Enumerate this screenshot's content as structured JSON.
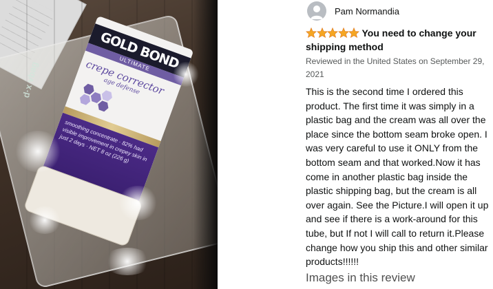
{
  "photo": {
    "alt": "Customer photo of Gold Bond crepe corrector tube in a plastic bag",
    "brand_text": "GOLD BOND",
    "sub_text": "ULTIMATE",
    "product_line1": "crepe corrector",
    "product_line2": "age defense",
    "purple_text": "smoothing concentrate · 82% had visible improvement in crepey skin in just 2 days · NET 8 oz (226 g)",
    "side_text": "d·x vbag"
  },
  "review": {
    "reviewer_name": "Pam Normandia",
    "rating": 5,
    "title": "You need to change your shipping method",
    "meta": "Reviewed in the United States on September 29, 2021",
    "body": "This is the second time I ordered this product. The first time it was simply in a plastic bag and the cream was all over the place since the bottom seam broke open. I was very careful to use it ONLY from the bottom seam and that worked.Now it has come in another plastic bag inside the plastic shipping bag, but the cream is all over again. See the Picture.I will open it up and see if there is a work-around for this tube, but If not I will call to return it.Please change how you ship this and other similar products!!!!!!",
    "images_heading": "Images in this review"
  },
  "colors": {
    "star": "#f5a623",
    "star_outline": "#de7921",
    "meta_text": "#565959",
    "heading_text": "#4f4f4f"
  },
  "icons": {
    "avatar": "user-silhouette-icon",
    "star": "star-filled-icon"
  }
}
